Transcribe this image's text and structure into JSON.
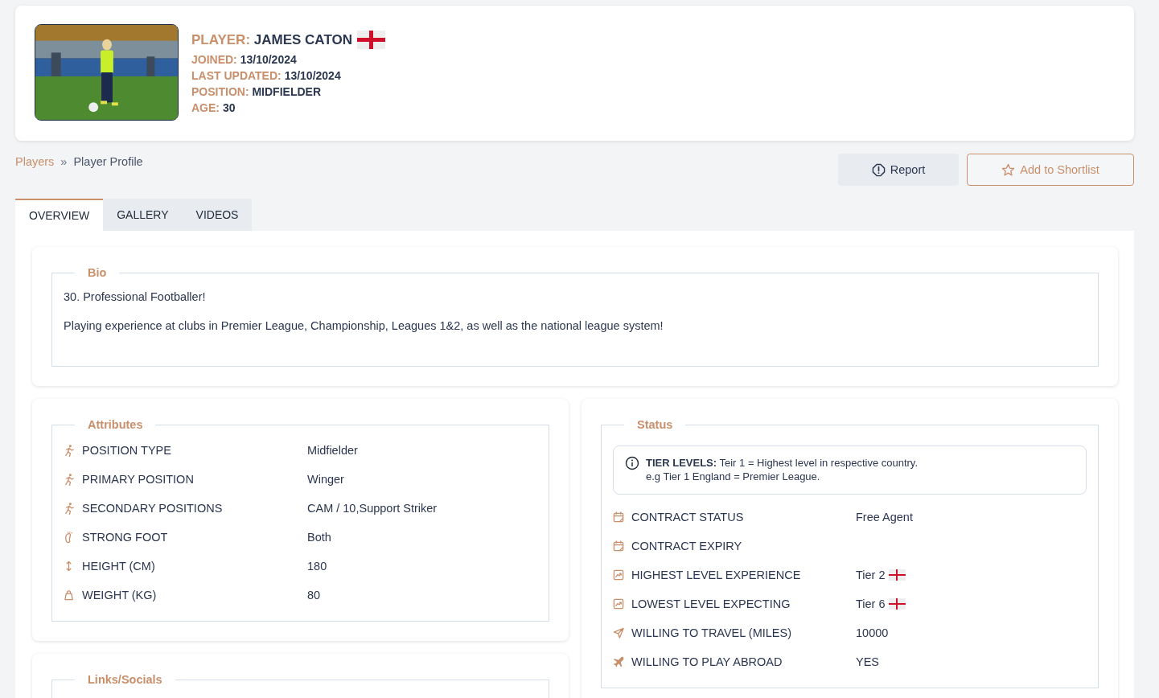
{
  "player": {
    "heading_label": "PLAYER:",
    "name": "JAMES CATON",
    "has_flag": true,
    "details": [
      {
        "label": "JOINED:",
        "value": "13/10/2024"
      },
      {
        "label": "LAST UPDATED:",
        "value": "13/10/2024"
      },
      {
        "label": "POSITION:",
        "value": "MIDFIELDER"
      },
      {
        "label": "AGE:",
        "value": "30"
      }
    ]
  },
  "breadcrumb": {
    "link": "Players",
    "separator": "»",
    "current": "Player Profile"
  },
  "actions": [
    {
      "kind": "report",
      "label": "Report"
    },
    {
      "kind": "shortlist",
      "label": "Add to Shortlist"
    }
  ],
  "tabs": [
    {
      "label": "OVERVIEW",
      "selected": true
    },
    {
      "label": "GALLERY",
      "selected": false
    },
    {
      "label": "VIDEOS",
      "selected": false
    }
  ],
  "bio": {
    "title": "Bio",
    "paragraphs": [
      "30. Professional Footballer!",
      "Playing experience at clubs in Premier League, Championship, Leagues 1&2, as well as the national league system!"
    ]
  },
  "attributes": {
    "title": "Attributes",
    "rows": [
      {
        "kind": "position",
        "label": "POSITION TYPE",
        "value": "Midfielder"
      },
      {
        "kind": "position",
        "label": "PRIMARY POSITION",
        "value": "Winger"
      },
      {
        "kind": "position",
        "label": "SECONDARY POSITIONS",
        "value": "CAM / 10,Support Striker"
      },
      {
        "kind": "foot",
        "label": "STRONG FOOT",
        "value": "Both"
      },
      {
        "kind": "height",
        "label": "HEIGHT (CM)",
        "value": "180"
      },
      {
        "kind": "weight",
        "label": "WEIGHT (KG)",
        "value": "80"
      }
    ]
  },
  "links": {
    "title": "Links/Socials"
  },
  "status": {
    "title": "Status",
    "notice": "**TIER LEVELS:** Teir 1 = Highest level in respective country.\ne.g Tier 1 England = Premier League.",
    "rows": [
      {
        "kind": "contract",
        "label": "CONTRACT STATUS",
        "value": "Free Agent"
      },
      {
        "kind": "contract",
        "label": "CONTRACT EXPIRY"
      },
      {
        "kind": "level",
        "label": "HIGHEST LEVEL EXPERIENCE",
        "value": "Tier 2",
        "has_flag": true
      },
      {
        "kind": "level",
        "label": "LOWEST LEVEL EXPECTING",
        "value": "Tier 6",
        "has_flag": true
      },
      {
        "kind": "travel",
        "label": "WILLING TO TRAVEL (MILES)",
        "value": "10000"
      },
      {
        "kind": "abroad",
        "label": "WILLING TO PLAY ABROAD",
        "value": "YES"
      }
    ]
  }
}
